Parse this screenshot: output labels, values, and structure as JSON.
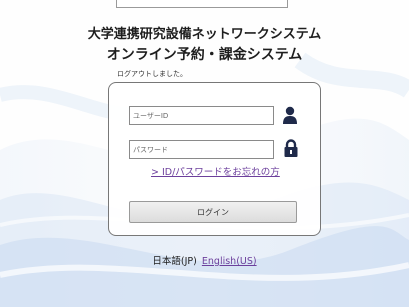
{
  "header": {
    "title_line1": "大学連携研究設備ネットワークシステム",
    "title_line2": "オンライン予約・課金システム"
  },
  "status": {
    "message": "ログアウトしました。"
  },
  "login_form": {
    "user_id_placeholder": "ユーザーID",
    "user_id_value": "",
    "password_placeholder": "パスワード",
    "password_value": "",
    "forgot_link": "> ID/パスワードをお忘れの方",
    "login_button": "ログイン",
    "user_icon": "user-icon",
    "lock_icon": "lock-icon"
  },
  "language": {
    "current": "日本語(JP)",
    "english_link": "English(US)"
  },
  "colors": {
    "link": "#6c3f9c",
    "icon": "#1f2a4a",
    "wave": "#c9daf0"
  }
}
